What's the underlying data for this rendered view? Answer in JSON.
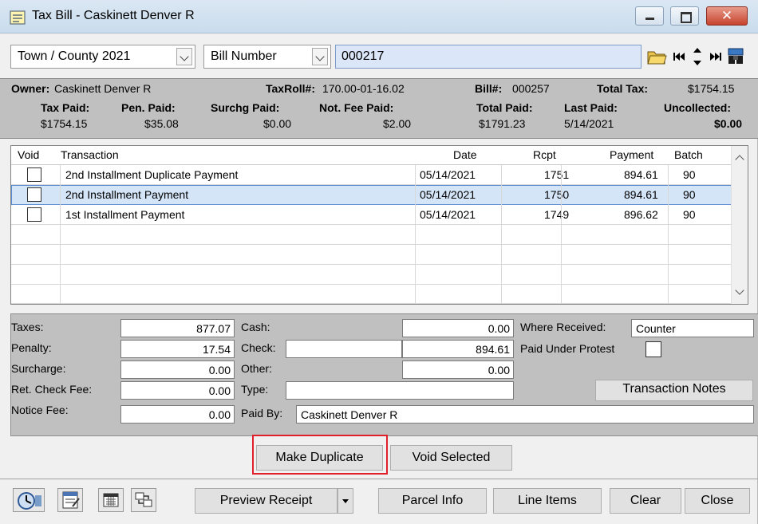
{
  "window": {
    "title": "Tax Bill - Caskinett Denver R"
  },
  "selectors": {
    "tax_roll": "Town / County 2021",
    "search_by": "Bill Number",
    "search_value": "000217"
  },
  "info": {
    "owner_label": "Owner:",
    "owner_value": "Caskinett Denver R",
    "taxroll_label": "TaxRoll#:",
    "taxroll_value": "170.00-01-16.02",
    "bill_label": "Bill#:",
    "bill_value": "000257",
    "total_tax_label": "Total Tax:",
    "total_tax_value": "$1754.15",
    "tax_paid_label": "Tax Paid:",
    "tax_paid_value": "$1754.15",
    "pen_paid_label": "Pen. Paid:",
    "pen_paid_value": "$35.08",
    "surchg_paid_label": "Surchg Paid:",
    "surchg_paid_value": "$0.00",
    "not_fee_paid_label": "Not. Fee Paid:",
    "not_fee_paid_value": "$2.00",
    "total_paid_label": "Total Paid:",
    "total_paid_value": "$1791.23",
    "last_paid_label": "Last Paid:",
    "last_paid_value": "5/14/2021",
    "uncollected_label": "Uncollected:",
    "uncollected_value": "$0.00"
  },
  "grid": {
    "headers": {
      "void": "Void",
      "transaction": "Transaction",
      "date": "Date",
      "rcpt": "Rcpt",
      "payment": "Payment",
      "batch": "Batch"
    },
    "rows": [
      {
        "transaction": "2nd Installment Duplicate Payment",
        "date": "05/14/2021",
        "rcpt": "1751",
        "payment": "894.61",
        "batch": "90"
      },
      {
        "transaction": "2nd Installment Payment",
        "date": "05/14/2021",
        "rcpt": "1750",
        "payment": "894.61",
        "batch": "90"
      },
      {
        "transaction": "1st Installment Payment",
        "date": "05/14/2021",
        "rcpt": "1749",
        "payment": "896.62",
        "batch": "90"
      }
    ]
  },
  "detail": {
    "taxes_label": "Taxes:",
    "taxes_value": "877.07",
    "penalty_label": "Penalty:",
    "penalty_value": "17.54",
    "surcharge_label": "Surcharge:",
    "surcharge_value": "0.00",
    "ret_check_label": "Ret. Check Fee:",
    "ret_check_value": "0.00",
    "notice_label": "Notice Fee:",
    "notice_value": "0.00",
    "cash_label": "Cash:",
    "cash_value": "0.00",
    "check_label": "Check:",
    "check_number": "",
    "check_value": "894.61",
    "other_label": "Other:",
    "other_value": "0.00",
    "type_label": "Type:",
    "type_value": "",
    "paid_by_label": "Paid By:",
    "paid_by_value": "Caskinett Denver R",
    "where_label": "Where Received:",
    "where_value": "Counter",
    "protest_label": "Paid Under Protest",
    "notes_button": "Transaction Notes"
  },
  "actions": {
    "make_duplicate": "Make Duplicate",
    "void_selected": "Void Selected"
  },
  "toolbar": {
    "preview_receipt": "Preview Receipt",
    "parcel_info": "Parcel Info",
    "line_items": "Line Items",
    "clear": "Clear",
    "close": "Close"
  },
  "colors": {
    "accent_blue": "#dbe6f8",
    "highlight_red": "#e0202a",
    "panel_gray": "#c0c0c0"
  }
}
